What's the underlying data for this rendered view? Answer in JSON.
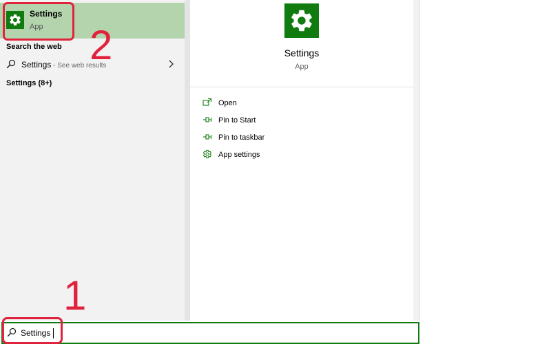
{
  "best_match": {
    "title": "Settings",
    "subtitle": "App",
    "icon": "gear-icon"
  },
  "search_web": {
    "heading": "Search the web",
    "item_label": "Settings",
    "item_hint": " - See web results",
    "icon": "search-icon",
    "chevron": "chevron-right-icon"
  },
  "more_results": {
    "heading": "Settings (8+)"
  },
  "detail": {
    "title": "Settings",
    "subtitle": "App",
    "icon": "gear-icon",
    "actions": [
      {
        "label": "Open",
        "icon": "open-icon"
      },
      {
        "label": "Pin to Start",
        "icon": "pin-icon"
      },
      {
        "label": "Pin to taskbar",
        "icon": "pin-icon"
      },
      {
        "label": "App settings",
        "icon": "gear-icon"
      }
    ]
  },
  "search_box": {
    "value": "Settings",
    "icon": "search-icon"
  },
  "annotations": {
    "step1": "1",
    "step2": "2"
  },
  "colors": {
    "accent": "#107c10",
    "selection": "#b3d4ad",
    "annotation": "#e0223d"
  }
}
